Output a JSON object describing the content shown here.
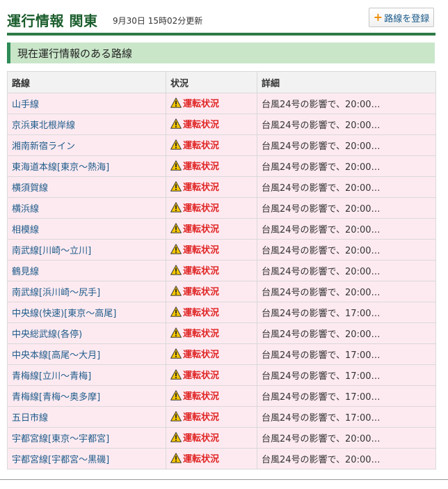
{
  "header": {
    "title": "運行情報 関東",
    "updated": "9月30日 15時02分更新",
    "register_button": "路線を登録"
  },
  "section_title": "現在運行情報のある路線",
  "table": {
    "columns": [
      "路線",
      "状況",
      "詳細"
    ],
    "rows": [
      {
        "line": "山手線",
        "status": "運転状況",
        "detail": "台風24号の影響で、20:00…"
      },
      {
        "line": "京浜東北根岸線",
        "status": "運転状況",
        "detail": "台風24号の影響で、20:00…"
      },
      {
        "line": "湘南新宿ライン",
        "status": "運転状況",
        "detail": "台風24号の影響で、20:00…"
      },
      {
        "line": "東海道本線[東京～熱海]",
        "status": "運転状況",
        "detail": "台風24号の影響で、20:00…"
      },
      {
        "line": "横須賀線",
        "status": "運転状況",
        "detail": "台風24号の影響で、20:00…"
      },
      {
        "line": "横浜線",
        "status": "運転状況",
        "detail": "台風24号の影響で、20:00…"
      },
      {
        "line": "相模線",
        "status": "運転状況",
        "detail": "台風24号の影響で、20:00…"
      },
      {
        "line": "南武線[川崎～立川]",
        "status": "運転状況",
        "detail": "台風24号の影響で、20:00…"
      },
      {
        "line": "鶴見線",
        "status": "運転状況",
        "detail": "台風24号の影響で、20:00…"
      },
      {
        "line": "南武線[浜川崎～尻手]",
        "status": "運転状況",
        "detail": "台風24号の影響で、20:00…"
      },
      {
        "line": "中央線(快速)[東京～高尾]",
        "status": "運転状況",
        "detail": "台風24号の影響で、17:00…"
      },
      {
        "line": "中央総武線(各停)",
        "status": "運転状況",
        "detail": "台風24号の影響で、20:00…"
      },
      {
        "line": "中央本線[高尾～大月]",
        "status": "運転状況",
        "detail": "台風24号の影響で、17:00…"
      },
      {
        "line": "青梅線[立川～青梅]",
        "status": "運転状況",
        "detail": "台風24号の影響で、17:00…"
      },
      {
        "line": "青梅線[青梅～奥多摩]",
        "status": "運転状況",
        "detail": "台風24号の影響で、17:00…"
      },
      {
        "line": "五日市線",
        "status": "運転状況",
        "detail": "台風24号の影響で、17:00…"
      },
      {
        "line": "宇都宮線[東京～宇都宮]",
        "status": "運転状況",
        "detail": "台風24号の影響で、20:00…"
      },
      {
        "line": "宇都宮線[宇都宮～黒磯]",
        "status": "運転状況",
        "detail": "台風24号の影響で、20:00…"
      }
    ]
  },
  "colors": {
    "brand_green": "#1b5e2d",
    "section_bg": "#c9e6c9",
    "row_bg": "#fdeaf0",
    "link": "#1f5c8b",
    "alert": "#e02424",
    "warning_yellow": "#f7c600"
  },
  "icons": {
    "register": "plus-icon",
    "status": "warning-triangle-icon"
  }
}
